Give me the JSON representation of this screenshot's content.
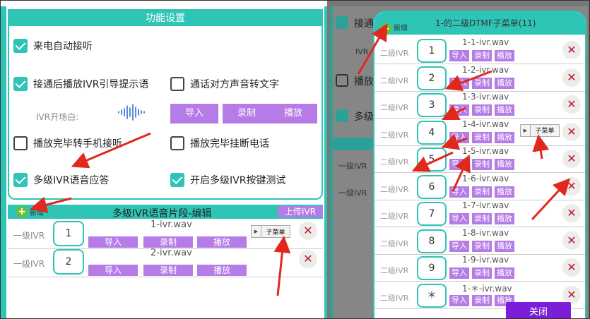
{
  "settings": {
    "title": "功能设置",
    "auto_answer": "来电自动接听",
    "play_ivr": "接通后播放IVR引导提示语",
    "speech_to_text": "通话对方声音转文字",
    "ivr_opening": "IVR开场白:",
    "btn_import": "导入",
    "btn_record": "录制",
    "btn_play": "播放",
    "transfer_phone": "播放完毕转手机接听",
    "hangup": "播放完毕挂断电话",
    "multi_ivr": "多级IVR语音应答",
    "multi_ivr_test": "开启多级IVR按键测试"
  },
  "segment_bar": {
    "add_label": "新增",
    "title": "多级IVR语音片段-编辑",
    "upload": "上传IVR"
  },
  "level1_rows": [
    {
      "label": "一级IVR",
      "num": "1",
      "file": "1-ivr.wav",
      "import": "导入",
      "record": "录制",
      "play": "播放",
      "submenu": "子菜单"
    },
    {
      "label": "一级IVR",
      "num": "2",
      "file": "2-ivr.wav",
      "import": "导入",
      "record": "录制",
      "play": "播放"
    }
  ],
  "background": {
    "connect_text": "接通",
    "ivr_text": "IVR",
    "play_text": "播放",
    "multi_text": "多级",
    "level1_a": "一级IVR",
    "level1_b": "一级IVR"
  },
  "dialog": {
    "add_label": "新增",
    "title": "1-的二级DTMF子菜单(11)",
    "rows": [
      {
        "label": "二级IVR",
        "num": "1",
        "file": "1-1-ivr.wav"
      },
      {
        "label": "二级IVR",
        "num": "2",
        "file": "1-2-ivr.wav"
      },
      {
        "label": "二级IVR",
        "num": "3",
        "file": "1-3-ivr.wav"
      },
      {
        "label": "二级IVR",
        "num": "4",
        "file": "1-4-ivr.wav",
        "submenu": "子菜单"
      },
      {
        "label": "二级IVR",
        "num": "5",
        "file": "1-5-ivr.wav"
      },
      {
        "label": "二级IVR",
        "num": "6",
        "file": "1-6-ivr.wav"
      },
      {
        "label": "二级IVR",
        "num": "7",
        "file": "1-7-ivr.wav"
      },
      {
        "label": "二级IVR",
        "num": "8",
        "file": "1-8-ivr.wav"
      },
      {
        "label": "二级IVR",
        "num": "9",
        "file": "1-9-ivr.wav"
      },
      {
        "label": "二级IVR",
        "num": "＊",
        "file": "1-＊-ivr.wav"
      }
    ],
    "btn_import": "导入",
    "btn_record": "录制",
    "btn_play": "播放",
    "close": "关闭"
  },
  "colors": {
    "teal": "#2ec4b6",
    "purple": "#b57be6",
    "close_purple": "#7a1ed8",
    "delete_red": "#c0162b",
    "arrow_red": "#e0281c"
  }
}
